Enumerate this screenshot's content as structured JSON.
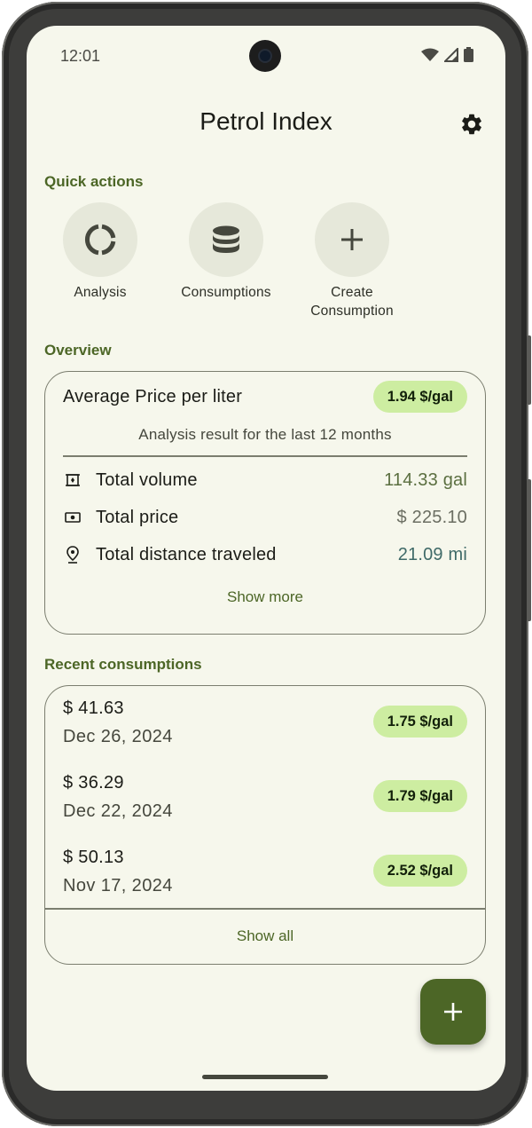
{
  "status_bar": {
    "time": "12:01"
  },
  "app_bar": {
    "title": "Petrol Index"
  },
  "quick_actions": {
    "heading": "Quick actions",
    "items": [
      {
        "label": "Analysis",
        "icon": "donut-chart-icon"
      },
      {
        "label": "Consumptions",
        "icon": "database-icon"
      },
      {
        "label": "Create\nConsumption",
        "icon": "plus-icon"
      }
    ]
  },
  "overview": {
    "heading": "Overview",
    "title": "Average Price per liter",
    "avg_price": "1.94 $/gal",
    "subtitle": "Analysis result for the last 12 months",
    "stats": [
      {
        "label": "Total volume",
        "value": "114.33 gal",
        "icon": "volume-icon",
        "color": "#5b6f40"
      },
      {
        "label": "Total price",
        "value": "$ 225.10",
        "icon": "money-icon",
        "color": "#6b6e62"
      },
      {
        "label": "Total distance traveled",
        "value": "21.09 mi",
        "icon": "location-pin-icon",
        "color": "#3f6a68"
      }
    ],
    "show_more": "Show more"
  },
  "recent": {
    "heading": "Recent consumptions",
    "items": [
      {
        "amount": "$ 41.63",
        "date": "Dec 26, 2024",
        "price": "1.75 $/gal"
      },
      {
        "amount": "$ 36.29",
        "date": "Dec 22, 2024",
        "price": "1.79 $/gal"
      },
      {
        "amount": "$ 50.13",
        "date": "Nov 17, 2024",
        "price": "2.52 $/gal"
      }
    ],
    "show_all": "Show all"
  },
  "colors": {
    "accent": "#4c6626",
    "chip": "#cdeda1",
    "background": "#f6f7ec"
  }
}
